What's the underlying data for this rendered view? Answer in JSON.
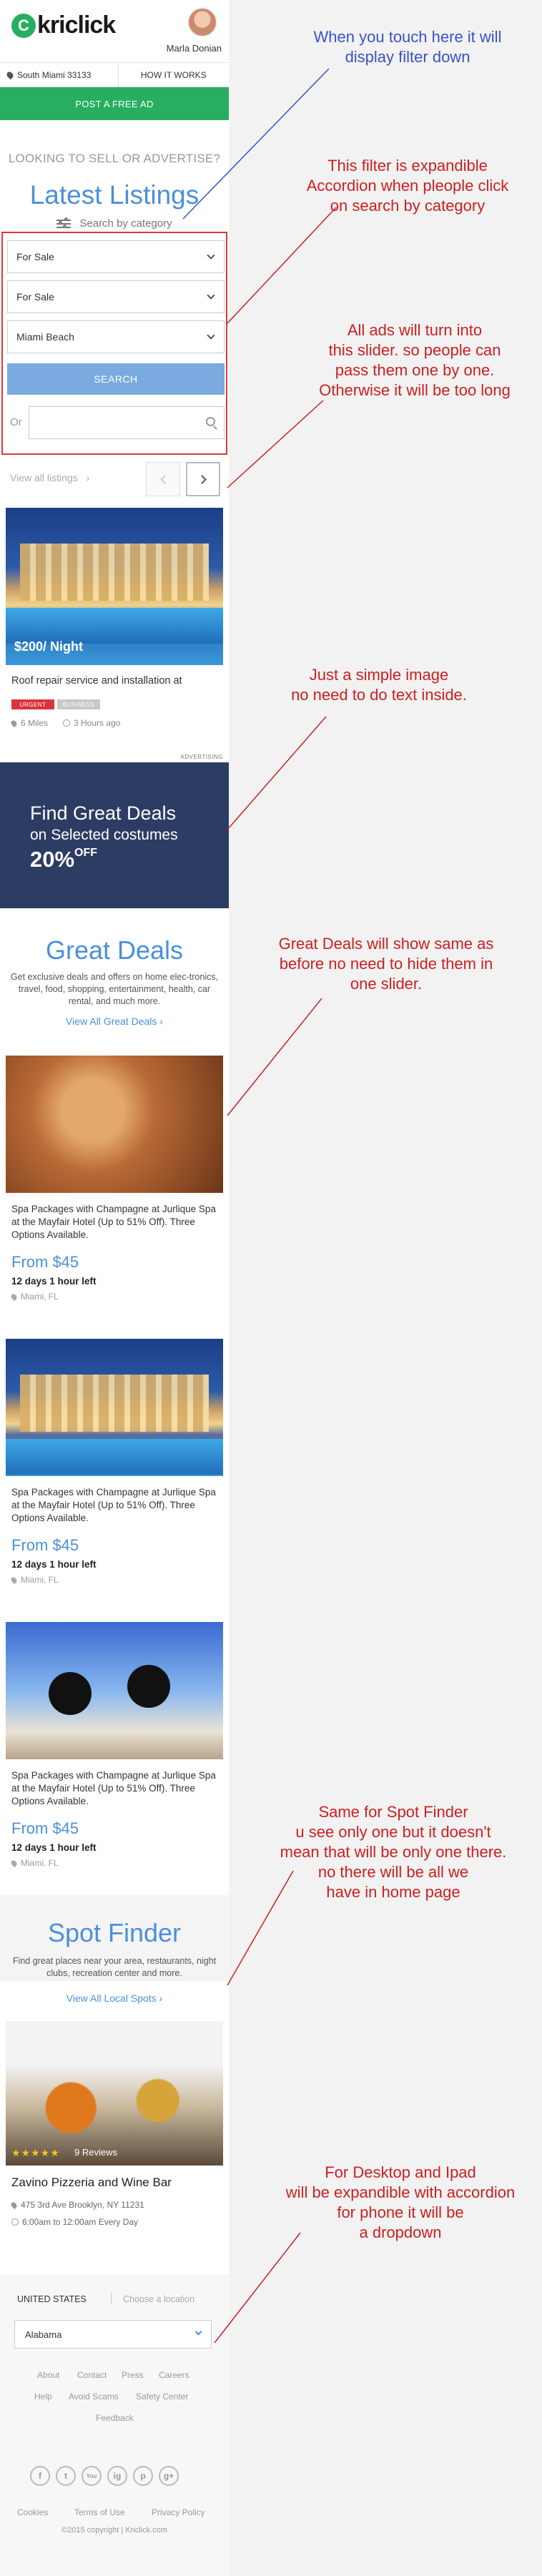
{
  "header": {
    "logo_mark": "C",
    "logo_text": "kriclick",
    "username": "Marla Donian",
    "location": "South Miami 33133",
    "how_it_works": "HOW IT WORKS",
    "post_ad": "POST A FREE AD"
  },
  "hero": {
    "question": "LOOKING TO SELL OR ADVERTISE?",
    "title": "Latest Listings",
    "search_by_category": "Search by category"
  },
  "filter": {
    "select1": "For Sale",
    "select2": "For Sale",
    "select3": "Miami Beach",
    "search_button": "SEARCH",
    "or_label": "Or",
    "input_value": ""
  },
  "listings_nav": {
    "view_all": "View all listings"
  },
  "listing": {
    "price": "$200/ Night",
    "title": "Roof repair service and installation at",
    "badge_urgent": "URGENT",
    "badge_business": "BUSINESS",
    "distance": "6 Miles",
    "posted": "3 Hours ago"
  },
  "advert": {
    "label": "ADVERTISING",
    "line1": "Find Great Deals",
    "line2": "on Selected costumes",
    "percent": "20%",
    "off": "OFF"
  },
  "great_deals": {
    "title": "Great Deals",
    "description": "Get exclusive deals and offers on home elec-tronics, travel, food, shopping, entertainment, health, car rental, and much more.",
    "link": "View All Great Deals",
    "items": [
      {
        "title": "Spa Packages with Champagne at Jurlique Spa at the Mayfair Hotel (Up to 51% Off). Three Options Available.",
        "price": "From $45",
        "time_left": "12 days 1 hour left",
        "location": "Miami, FL"
      },
      {
        "title": "Spa Packages with Champagne at Jurlique Spa at the Mayfair Hotel (Up to 51% Off). Three Options Available.",
        "price": "From $45",
        "time_left": "12 days 1 hour left",
        "location": "Miami, FL"
      },
      {
        "title": "Spa Packages with Champagne at Jurlique Spa at the Mayfair Hotel (Up to 51% Off). Three Options Available.",
        "price": "From $45",
        "time_left": "12 days 1 hour left",
        "location": "Miami, FL"
      }
    ]
  },
  "spot_finder": {
    "title": "Spot Finder",
    "description": "Find great places near your area, restaurants, night clubs, recreation center and more.",
    "link": "View All Local Spots",
    "stars": "★★★★★",
    "rating": 5,
    "reviews": "9 Reviews",
    "name": "Zavino Pizzeria and Wine Bar",
    "address": "475 3rd Ave Brooklyn, NY 11231",
    "hours": "6:00am to 12:00am Every Day"
  },
  "footer": {
    "country": "UNITED STATES",
    "choose_location": "Choose a location",
    "state_select": "Alabama",
    "links": [
      "About",
      "Contact",
      "Press",
      "Careers",
      "Help",
      "Avoid Scams",
      "Safety Center",
      "Feedback"
    ],
    "social": [
      "f",
      "t",
      "You",
      "ig",
      "p",
      "g+"
    ],
    "bottom_links": [
      "Cookies",
      "Terms of Use",
      "Privacy Policy"
    ],
    "copyright": "©2015 copyright  |  Kriclick.com"
  },
  "annotations": [
    "When you touch here it will\ndisplay filter down",
    "This filter is expandible\nAccordion when pleople click\non search by category",
    "All ads will turn into\nthis slider. so people can\npass them one by one.\nOtherwise it will be too long",
    "Just a simple image\nno need to do text inside.",
    "Great Deals will show same as\nbefore no need to hide them in\none slider.",
    "Same for Spot Finder\nu see only one but it doesn't\nmean that will be only one there.\nno there will be all we\nhave in home page",
    "For Desktop and Ipad\nwill be expandible with accordion\nfor phone it will be\na dropdown"
  ],
  "colors": {
    "brand_green": "#27ae60",
    "accent_blue": "#4a90d9",
    "annotation_red": "#cc1f1f",
    "annotation_blue": "#3a52c8",
    "banner_navy": "#2d3c63"
  }
}
